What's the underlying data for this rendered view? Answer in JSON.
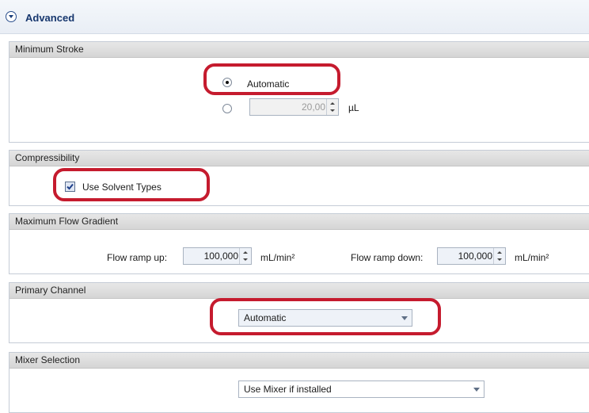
{
  "header": {
    "title": "Advanced",
    "icon": "collapse-circle-icon"
  },
  "sections": {
    "minimum_stroke": {
      "title": "Minimum Stroke",
      "automatic_label": "Automatic",
      "automatic_selected": true,
      "manual_value": "20,00",
      "manual_unit": "µL"
    },
    "compressibility": {
      "title": "Compressibility",
      "checkbox_label": "Use Solvent Types",
      "checked": true
    },
    "max_flow_gradient": {
      "title": "Maximum Flow Gradient",
      "ramp_up_label": "Flow ramp up:",
      "ramp_up_value": "100,000",
      "ramp_up_unit": "mL/min²",
      "ramp_down_label": "Flow ramp down:",
      "ramp_down_value": "100,000",
      "ramp_down_unit": "mL/min²"
    },
    "primary_channel": {
      "title": "Primary Channel",
      "selected": "Automatic"
    },
    "mixer_selection": {
      "title": "Mixer Selection",
      "selected": "Use Mixer if installed"
    }
  },
  "colors": {
    "highlight": "#c51b2e",
    "header_text": "#17376e"
  }
}
